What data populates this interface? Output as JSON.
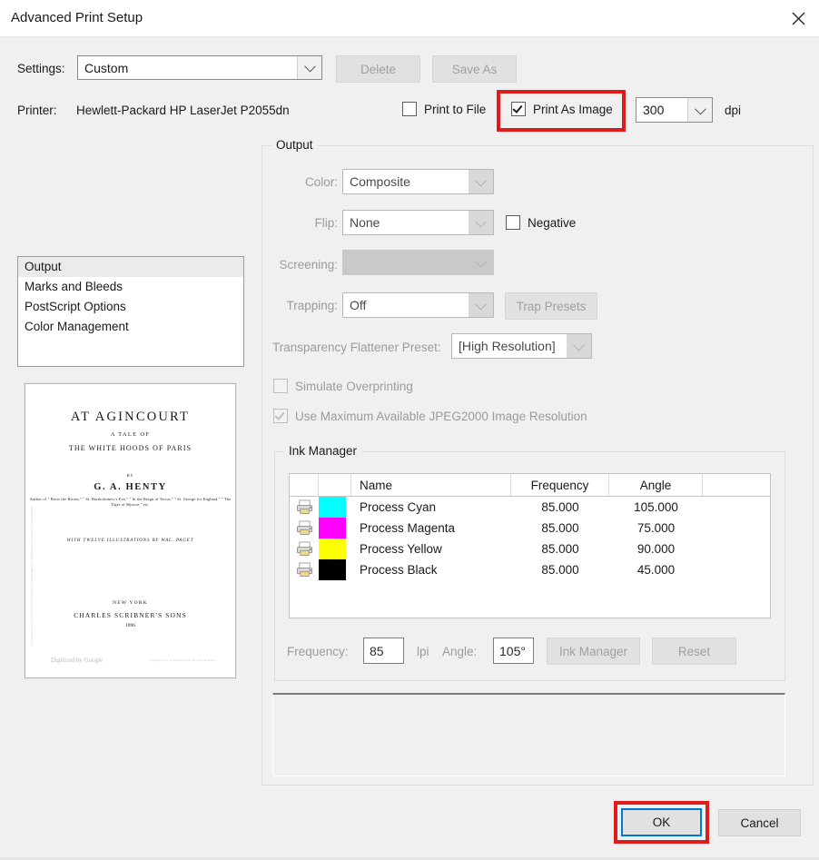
{
  "window": {
    "title": "Advanced Print Setup",
    "close_icon": "close-icon"
  },
  "settings": {
    "label": "Settings:",
    "value": "Custom",
    "placeholder": "Custom",
    "delete_label": "Delete",
    "save_as_label": "Save As"
  },
  "printer": {
    "label": "Printer:",
    "value": "Hewlett-Packard HP LaserJet P2055dn",
    "print_to_file_label": "Print to File",
    "print_to_file_checked": false,
    "print_as_image_label": "Print As Image",
    "print_as_image_checked": true,
    "dpi_value": "300",
    "dpi_unit": "dpi"
  },
  "nav": {
    "items": [
      {
        "label": "Output",
        "selected": true
      },
      {
        "label": "Marks and Bleeds",
        "selected": false
      },
      {
        "label": "PostScript Options",
        "selected": false
      },
      {
        "label": "Color Management",
        "selected": false
      }
    ]
  },
  "preview": {
    "title": "AT  AGINCOURT",
    "subtitle1": "A TALE OF",
    "subtitle2": "THE WHITE HOODS OF PARIS",
    "by": "BY",
    "author": "G. A. HENTY",
    "works": "Author of \" Beric the Briton,\" \" St. Bartholomew's Eve,\" \" In the Reign of Terror,\" \" St. George for England,\" \" The Tiger of Mysore,\" etc.",
    "illustrations": "WITH TWELVE ILLUSTRATIONS BY WAL. PAGET",
    "city": "NEW YORK",
    "publisher": "CHARLES  SCRIBNER'S  SONS",
    "year": "1896",
    "google_mark": "Digitized by Google",
    "library_stamp": "Digitized by UNIVERSITY OF MICHIGAN",
    "spine_text": "Generated for Jane Doe on 2015-09-01 / Public Domain, Google-digitized / http://www.hathitrust.org/access_use#pd-google"
  },
  "output": {
    "group_title": "Output",
    "color_label": "Color:",
    "color_value": "Composite",
    "flip_label": "Flip:",
    "flip_value": "None",
    "negative_label": "Negative",
    "negative_checked": false,
    "screening_label": "Screening:",
    "screening_value": "",
    "trapping_label": "Trapping:",
    "trapping_value": "Off",
    "trap_presets_label": "Trap Presets",
    "tfp_label": "Transparency Flattener Preset:",
    "tfp_value": "[High Resolution]",
    "simulate_overprint_label": "Simulate Overprinting",
    "simulate_overprint_checked": false,
    "jpeg2000_label": "Use Maximum Available JPEG2000 Image Resolution",
    "jpeg2000_checked": true
  },
  "ink_manager": {
    "group_title": "Ink Manager",
    "columns": [
      "",
      "",
      "Name",
      "Frequency",
      "Angle",
      ""
    ],
    "rows": [
      {
        "icon": "printer-icon",
        "color": "#00ffff",
        "name": "Process Cyan",
        "frequency": "85.000",
        "angle": "105.000"
      },
      {
        "icon": "printer-icon",
        "color": "#ff00ff",
        "name": "Process Magenta",
        "frequency": "85.000",
        "angle": "75.000"
      },
      {
        "icon": "printer-icon",
        "color": "#ffff00",
        "name": "Process Yellow",
        "frequency": "85.000",
        "angle": "90.000"
      },
      {
        "icon": "printer-icon",
        "color": "#000000",
        "name": "Process Black",
        "frequency": "85.000",
        "angle": "45.000"
      }
    ],
    "frequency_label": "Frequency:",
    "frequency_value": "85",
    "lpi_label": "lpi",
    "angle_label": "Angle:",
    "angle_value": "105°",
    "ink_manager_button": "Ink Manager",
    "reset_button": "Reset"
  },
  "footer": {
    "ok_label": "OK",
    "cancel_label": "Cancel"
  },
  "annotations": {
    "highlight_color": "#e01b1b",
    "focus_color": "#0078d7"
  }
}
